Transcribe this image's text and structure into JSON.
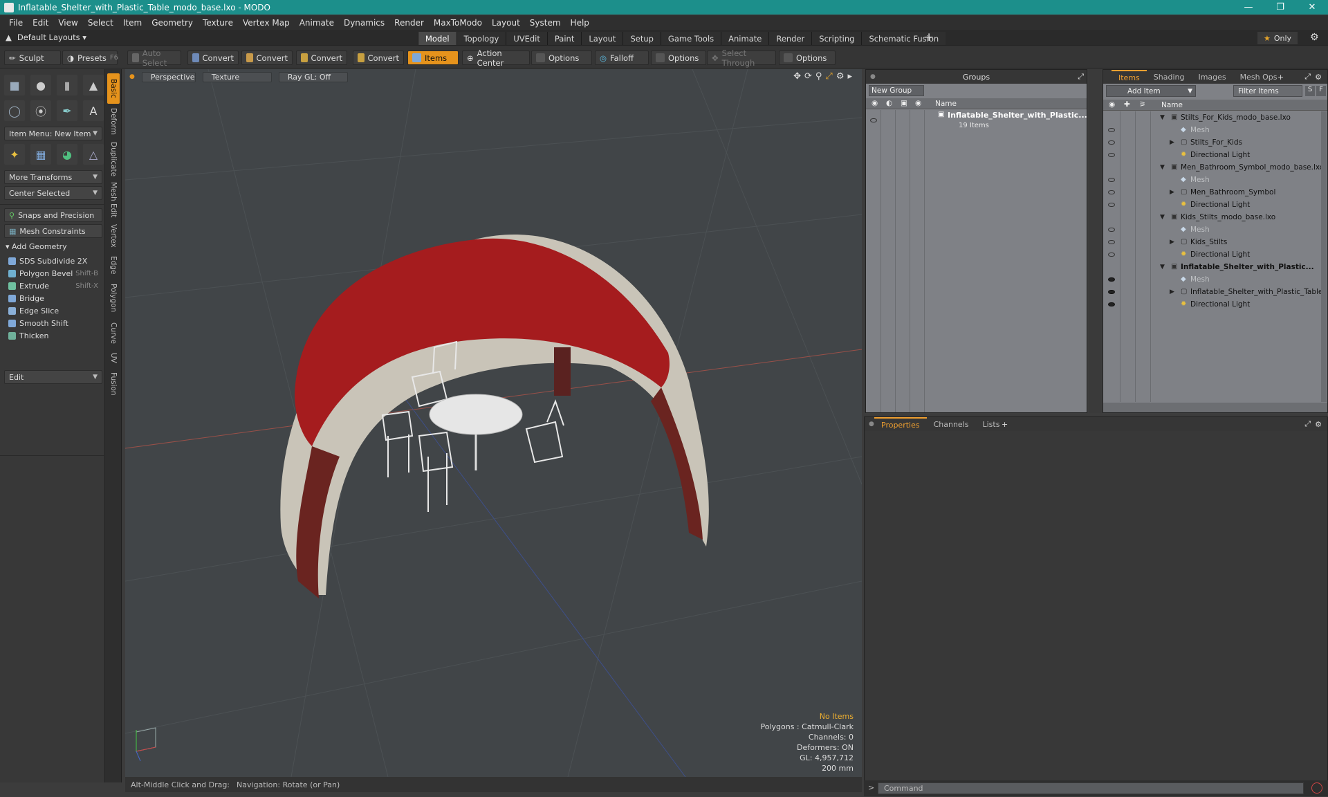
{
  "window": {
    "title": "Inflatable_Shelter_with_Plastic_Table_modo_base.lxo - MODO"
  },
  "menu": [
    "File",
    "Edit",
    "View",
    "Select",
    "Item",
    "Geometry",
    "Texture",
    "Vertex Map",
    "Animate",
    "Dynamics",
    "Render",
    "MaxToModo",
    "Layout",
    "System",
    "Help"
  ],
  "layouts": {
    "label": "Default Layouts",
    "tabs": [
      "Model",
      "Topology",
      "UVEdit",
      "Paint",
      "Layout",
      "Setup",
      "Game Tools",
      "Animate",
      "Render",
      "Scripting",
      "Schematic Fusion"
    ],
    "active": "Model",
    "only": "Only"
  },
  "toolbar": {
    "sculpt": "Sculpt",
    "presets": "Presets",
    "presets_key": "F6",
    "auto_select": "Auto Select",
    "convert": "Convert",
    "items": "Items",
    "action_center": "Action Center",
    "options": "Options",
    "falloff": "Falloff",
    "select_through": "Select Through"
  },
  "left": {
    "item_menu": "Item Menu: New Item",
    "more_transforms": "More Transforms",
    "center_selected": "Center Selected",
    "snaps": "Snaps and Precision",
    "mesh_constraints": "Mesh Constraints",
    "add_geometry": "Add Geometry",
    "tools": [
      {
        "label": "SDS Subdivide 2X",
        "key": ""
      },
      {
        "label": "Polygon Bevel",
        "key": "Shift-B"
      },
      {
        "label": "Extrude",
        "key": "Shift-X"
      },
      {
        "label": "Bridge",
        "key": ""
      },
      {
        "label": "Edge Slice",
        "key": ""
      },
      {
        "label": "Smooth Shift",
        "key": ""
      },
      {
        "label": "Thicken",
        "key": ""
      }
    ],
    "edit": "Edit"
  },
  "vtabs": [
    "Basic",
    "Deform",
    "Duplicate",
    "Mesh Edit",
    "Vertex",
    "Edge",
    "Polygon",
    "Curve",
    "UV",
    "Fusion"
  ],
  "viewport": {
    "perspective": "Perspective",
    "texture": "Texture",
    "raygl": "Ray GL: Off",
    "info": {
      "items": "No Items",
      "polygons": "Polygons : Catmull-Clark",
      "channels": "Channels: 0",
      "deformers": "Deformers: ON",
      "gl": "GL: 4,957,712",
      "size": "200 mm"
    }
  },
  "status": {
    "hint": "Alt-Middle Click and Drag:",
    "action": "Navigation: Rotate (or Pan)"
  },
  "groups": {
    "title": "Groups",
    "new_group": "New Group",
    "name_col": "Name",
    "entry": "Inflatable_Shelter_with_Plastic...",
    "count": "19 Items"
  },
  "items": {
    "tabs": [
      "Items",
      "Shading",
      "Images",
      "Mesh Ops"
    ],
    "add_item": "Add Item",
    "filter": "Filter Items",
    "s": "S",
    "f": "F",
    "name_col": "Name",
    "rows": [
      {
        "label": "Stilts_For_Kids_modo_base.lxo",
        "level": 0,
        "type": "scene",
        "style": ""
      },
      {
        "label": "Mesh",
        "level": 1,
        "type": "mesh",
        "style": "dim"
      },
      {
        "label": "Stilts_For_Kids",
        "level": 1,
        "type": "group",
        "style": ""
      },
      {
        "label": "Directional Light",
        "level": 1,
        "type": "light",
        "style": ""
      },
      {
        "label": "Men_Bathroom_Symbol_modo_base.lxo",
        "level": 0,
        "type": "scene",
        "style": ""
      },
      {
        "label": "Mesh",
        "level": 1,
        "type": "mesh",
        "style": "dim"
      },
      {
        "label": "Men_Bathroom_Symbol",
        "level": 1,
        "type": "group",
        "style": ""
      },
      {
        "label": "Directional Light",
        "level": 1,
        "type": "light",
        "style": ""
      },
      {
        "label": "Kids_Stilts_modo_base.lxo",
        "level": 0,
        "type": "scene",
        "style": ""
      },
      {
        "label": "Mesh",
        "level": 1,
        "type": "mesh",
        "style": "dim"
      },
      {
        "label": "Kids_Stilts",
        "level": 1,
        "type": "group",
        "style": ""
      },
      {
        "label": "Directional Light",
        "level": 1,
        "type": "light",
        "style": ""
      },
      {
        "label": "Inflatable_Shelter_with_Plastic...",
        "level": 0,
        "type": "scene",
        "style": "bold"
      },
      {
        "label": "Mesh",
        "level": 1,
        "type": "mesh",
        "style": "dim"
      },
      {
        "label": "Inflatable_Shelter_with_Plastic_Table",
        "level": 1,
        "type": "group",
        "style": ""
      },
      {
        "label": "Directional Light",
        "level": 1,
        "type": "light",
        "style": ""
      }
    ]
  },
  "props": {
    "tabs": [
      "Properties",
      "Channels",
      "Lists"
    ]
  },
  "command": {
    "placeholder": "Command"
  }
}
